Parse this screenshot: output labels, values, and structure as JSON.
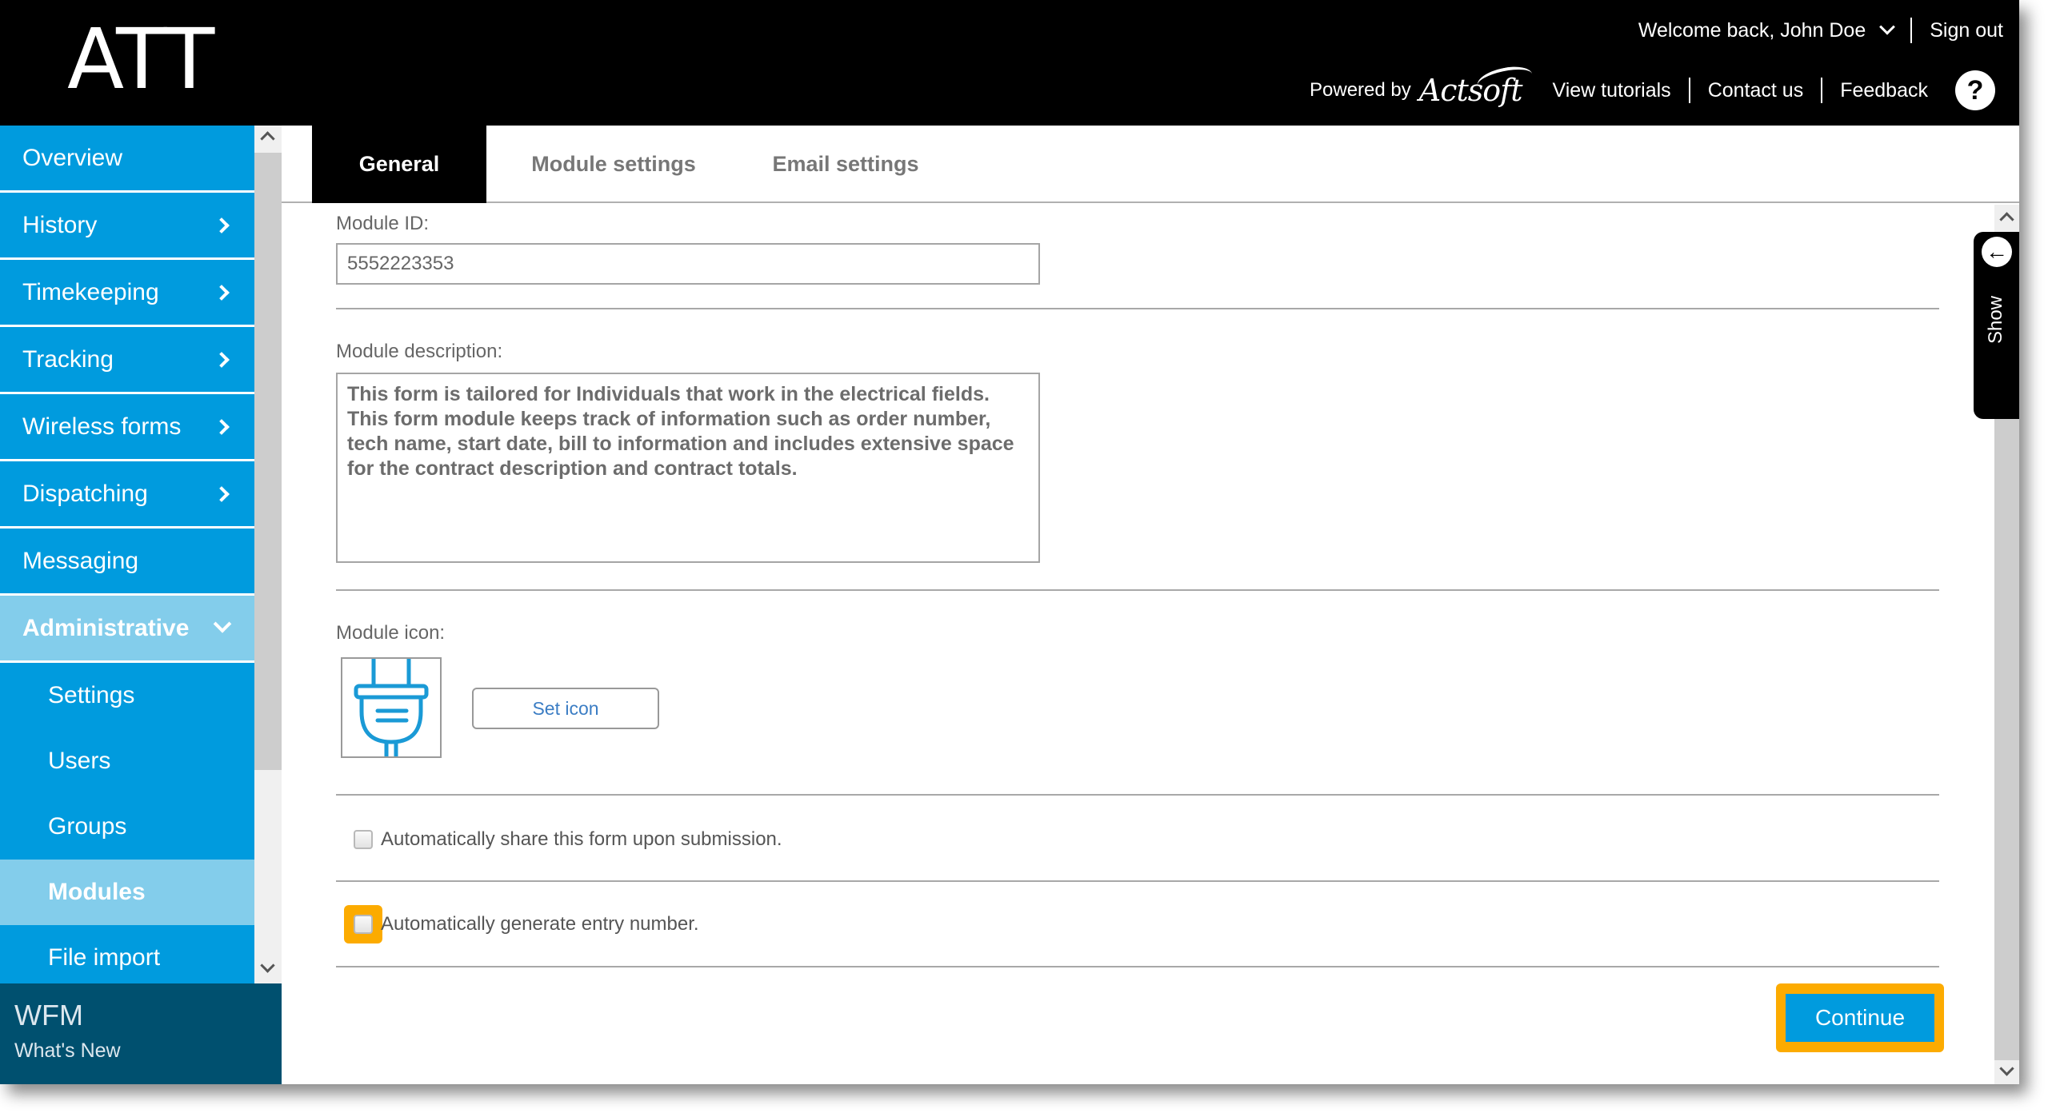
{
  "header": {
    "logo": "ATT",
    "welcome": "Welcome back, John Doe",
    "sign_out": "Sign out",
    "powered_by": "Powered by",
    "powered_brand": "Actsoft",
    "links": [
      "View tutorials",
      "Contact us",
      "Feedback"
    ],
    "help_glyph": "?"
  },
  "sidebar": {
    "items": [
      {
        "label": "Overview",
        "icon": "none"
      },
      {
        "label": "History",
        "icon": "chevron-right-icon"
      },
      {
        "label": "Timekeeping",
        "icon": "chevron-right-icon"
      },
      {
        "label": "Tracking",
        "icon": "chevron-right-icon"
      },
      {
        "label": "Wireless forms",
        "icon": "chevron-right-icon"
      },
      {
        "label": "Dispatching",
        "icon": "chevron-right-icon"
      },
      {
        "label": "Messaging",
        "icon": "none"
      },
      {
        "label": "Administrative",
        "icon": "chevron-down-icon",
        "expanded": true
      }
    ],
    "sub_items": [
      {
        "label": "Settings"
      },
      {
        "label": "Users"
      },
      {
        "label": "Groups"
      },
      {
        "label": "Modules",
        "active": true
      },
      {
        "label": "File import"
      }
    ],
    "footer": {
      "title": "WFM",
      "link": "What's New"
    }
  },
  "tabs": [
    {
      "label": "General",
      "active": true
    },
    {
      "label": "Module settings"
    },
    {
      "label": "Email settings"
    }
  ],
  "form": {
    "module_id_label": "Module ID:",
    "module_id_value": "5552223353",
    "description_label": "Module description:",
    "description_value": "This form is tailored for Individuals that work in the electrical fields. This form module keeps track of information such as order number, tech name, start date, bill to information and includes extensive space for the contract description and contract totals.",
    "icon_label": "Module icon:",
    "icon_name": "plug-icon",
    "set_icon_button": "Set icon",
    "share_checkbox": {
      "label": "Automatically share this form upon submission.",
      "checked": false
    },
    "entry_checkbox": {
      "label": "Automatically generate entry number.",
      "checked": false,
      "highlighted": true
    },
    "continue_button": "Continue"
  },
  "show_panel": {
    "label": "Show",
    "icon": "arrow-left-icon"
  },
  "colors": {
    "brand_blue": "#009bde",
    "active_blue": "#83cdeb",
    "footer_navy": "#00506f",
    "highlight_orange": "#fcab00",
    "header_black": "#000000"
  }
}
